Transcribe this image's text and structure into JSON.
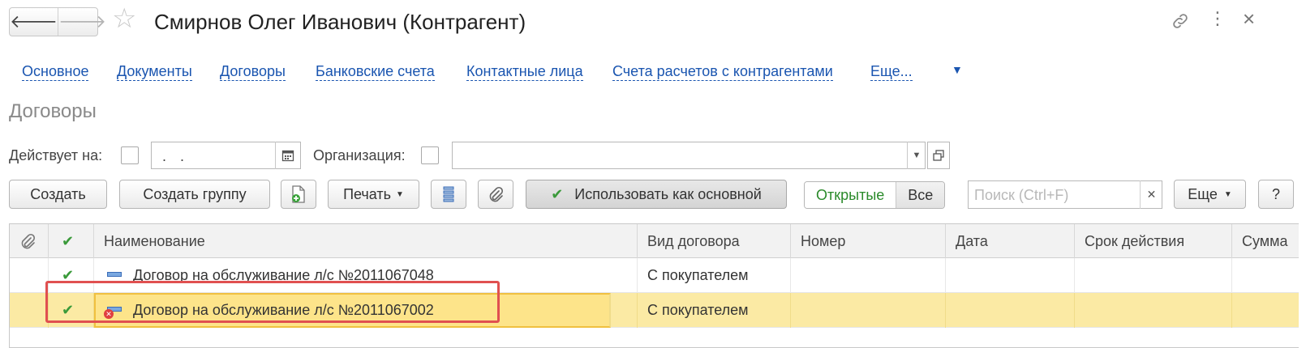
{
  "window": {
    "title": "Смирнов Олег Иванович (Контрагент)",
    "back_icon": "arrow-left-icon",
    "forward_icon": "arrow-right-icon",
    "star": "☆",
    "link_glyph": "🔗",
    "menu_glyph": "⋮",
    "close_glyph": "×"
  },
  "tabs": [
    {
      "label": "Основное"
    },
    {
      "label": "Документы"
    },
    {
      "label": "Договоры"
    },
    {
      "label": "Банковские счета"
    },
    {
      "label": "Контактные лица"
    },
    {
      "label": "Счета расчетов с контрагентами"
    },
    {
      "label": "Еще..."
    }
  ],
  "section": {
    "title": "Договоры"
  },
  "filters": {
    "valid_on_label": "Действует на:",
    "date_value": ". .",
    "organization_label": "Организация:",
    "organization_value": ""
  },
  "toolbar": {
    "create": "Создать",
    "create_group": "Создать группу",
    "print": "Печать",
    "use_as_main": "Использовать как основной",
    "open": "Открытые",
    "all": "Все",
    "search_placeholder": "Поиск (Ctrl+F)",
    "more": "Еще",
    "help": "?"
  },
  "grid": {
    "columns": [
      "Наименование",
      "Вид договора",
      "Номер",
      "Дата",
      "Срок действия",
      "Сумма"
    ],
    "rows": [
      {
        "name": "Договор на обслуживание л/с №2011067048",
        "kind": "С покупателем",
        "number": "",
        "date": "",
        "term": "",
        "sum": "",
        "deleted": false,
        "selected": false
      },
      {
        "name": "Договор на обслуживание л/с №2011067002",
        "kind": "С покупателем",
        "number": "",
        "date": "",
        "term": "",
        "sum": "",
        "deleted": true,
        "selected": true
      }
    ]
  },
  "colors": {
    "link": "#1a55b0",
    "selected_row": "#fbeaa4",
    "focus_border": "#f0c040",
    "highlight": "#e05050",
    "check": "#3a9a3a"
  }
}
